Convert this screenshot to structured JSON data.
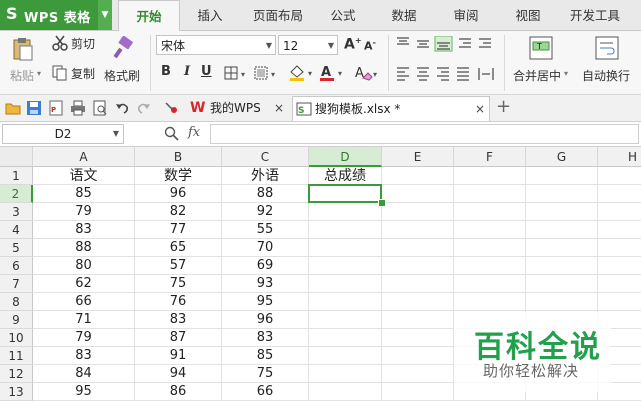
{
  "app": {
    "title": "WPS 表格",
    "logo_letter": "S"
  },
  "ribbon_tabs": [
    {
      "label": "开始",
      "active": true
    },
    {
      "label": "插入"
    },
    {
      "label": "页面布局"
    },
    {
      "label": "公式"
    },
    {
      "label": "数据"
    },
    {
      "label": "审阅"
    },
    {
      "label": "视图"
    },
    {
      "label": "开发工具"
    }
  ],
  "ribbon": {
    "paste_label": "粘贴",
    "cut_label": "剪切",
    "copy_label": "复制",
    "format_painter_label": "格式刷",
    "font_name": "宋体",
    "font_size": "12",
    "bold": "B",
    "italic": "I",
    "underline": "U",
    "merge_center_label": "合并居中",
    "wrap_text_label": "自动换行",
    "font_color": "#d9262c",
    "fill_color": "#f5c400"
  },
  "doc_tabs": [
    {
      "label": "我的WPS"
    },
    {
      "label": "搜狗模板.xlsx *",
      "active": true
    }
  ],
  "formula_bar": {
    "name_box": "D2",
    "fx_label": "fx",
    "value": ""
  },
  "sheet": {
    "columns": [
      "A",
      "B",
      "C",
      "D",
      "E",
      "F",
      "G",
      "H"
    ],
    "rows": [
      "1",
      "2",
      "3",
      "4",
      "5",
      "6",
      "7",
      "8",
      "9",
      "10",
      "11",
      "12",
      "13"
    ],
    "selected_cell": "D2",
    "data": [
      [
        "语文",
        "数学",
        "外语",
        "总成绩"
      ],
      [
        "85",
        "96",
        "88",
        ""
      ],
      [
        "79",
        "82",
        "92",
        ""
      ],
      [
        "83",
        "77",
        "55",
        ""
      ],
      [
        "88",
        "65",
        "70",
        ""
      ],
      [
        "80",
        "57",
        "69",
        ""
      ],
      [
        "62",
        "75",
        "93",
        ""
      ],
      [
        "66",
        "76",
        "95",
        ""
      ],
      [
        "71",
        "83",
        "96",
        ""
      ],
      [
        "79",
        "87",
        "83",
        ""
      ],
      [
        "83",
        "91",
        "85",
        ""
      ],
      [
        "84",
        "94",
        "75",
        ""
      ],
      [
        "95",
        "86",
        "66",
        ""
      ]
    ]
  },
  "watermark": {
    "title": "百科全说",
    "subtitle": "助你轻松解决"
  },
  "colors": {
    "accent": "#3d9a3a",
    "brand_green": "#22a04b"
  }
}
